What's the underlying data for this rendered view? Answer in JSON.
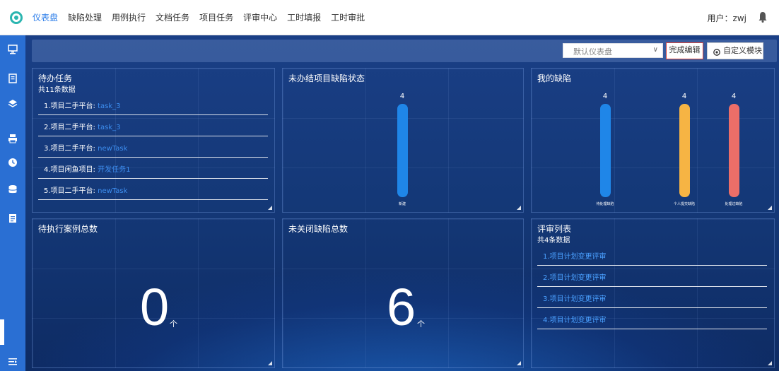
{
  "nav": {
    "items": [
      "仪表盘",
      "缺陷处理",
      "用例执行",
      "文档任务",
      "项目任务",
      "评审中心",
      "工时填报",
      "工时审批"
    ],
    "active_index": 0,
    "user_label": "用户：zwj"
  },
  "sidebar": {
    "icons": [
      "monitor-icon",
      "document-icon",
      "layers-icon",
      "printer-icon",
      "clock-icon",
      "database-icon",
      "file-icon",
      "menu-collapse-icon"
    ]
  },
  "toolbar": {
    "dashboard_select": "默认仪表盘",
    "done_label": "完成编辑",
    "custom_label": "自定义模块"
  },
  "todo": {
    "title": "待办任务",
    "count_label": "共11条数据",
    "items": [
      {
        "prefix": "1.项目二手平台:",
        "name": "task_3"
      },
      {
        "prefix": "2.项目二手平台:",
        "name": "task_3"
      },
      {
        "prefix": "3.项目二手平台:",
        "name": "newTask"
      },
      {
        "prefix": "4.项目闲鱼项目:",
        "name": "开发任务1"
      },
      {
        "prefix": "5.项目二手平台:",
        "name": "newTask"
      }
    ]
  },
  "unfinished_defects": {
    "title": "未办结项目缺陷状态"
  },
  "my_defects": {
    "title": "我的缺陷"
  },
  "pending_cases": {
    "title": "待执行案例总数",
    "value": "0",
    "unit": "个"
  },
  "unclosed_defects": {
    "title": "未关闭缺陷总数",
    "value": "6",
    "unit": "个"
  },
  "reviews": {
    "title": "评审列表",
    "count_label": "共4条数据",
    "items": [
      "1.项目计划变更评审",
      "2.项目计划变更评审",
      "3.项目计划变更评审",
      "4.项目计划变更评审"
    ]
  },
  "chart_data": [
    {
      "type": "bar",
      "title": "未办结项目缺陷状态",
      "categories": [
        "新建"
      ],
      "values": [
        4
      ],
      "colors": [
        "#1f86e8"
      ]
    },
    {
      "type": "bar",
      "title": "我的缺陷",
      "categories": [
        "待处理缺陷",
        "个人提交缺陷",
        "处理过缺陷"
      ],
      "values": [
        4,
        4,
        4
      ],
      "colors": [
        "#1f86e8",
        "#f6b444",
        "#ec6e68"
      ]
    }
  ]
}
